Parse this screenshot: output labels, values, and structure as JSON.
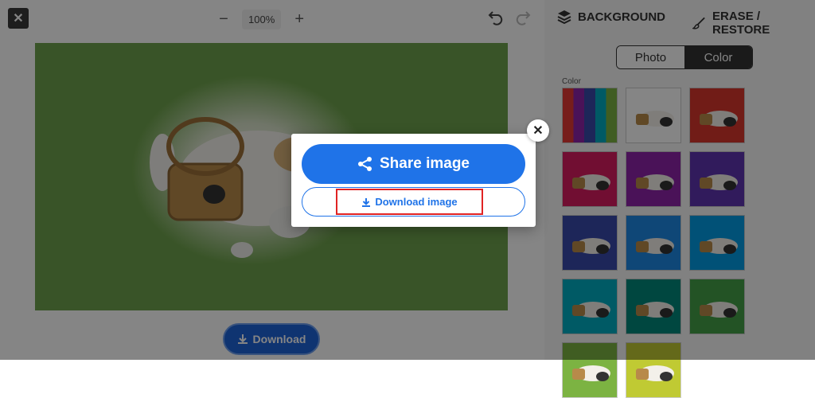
{
  "toolbar": {
    "close_symbol": "✕",
    "zoom_out": "−",
    "zoom_value": "100%",
    "zoom_in": "+"
  },
  "right_panel": {
    "tab_background": "BACKGROUND",
    "tab_erase_restore": "ERASE / RESTORE",
    "segment_photo": "Photo",
    "segment_color": "Color",
    "color_section_label": "Color",
    "swatches": [
      "transparent-grid",
      "#ffffff",
      "#d8362c",
      "#d81b60",
      "#8e24aa",
      "#5e35b1",
      "#3949ab",
      "#1e88e5",
      "#039be5",
      "#00acc1",
      "#00897b",
      "#43a047",
      "#7cb342",
      "#c0ca33"
    ]
  },
  "canvas": {
    "download_label": "Download"
  },
  "modal": {
    "share_label": "Share image",
    "download_image_label": "Download image",
    "close_symbol": "✕"
  },
  "colors": {
    "accent": "#1f73e8",
    "highlight": "#e02323",
    "canvas_bg": "#6ea24d"
  }
}
